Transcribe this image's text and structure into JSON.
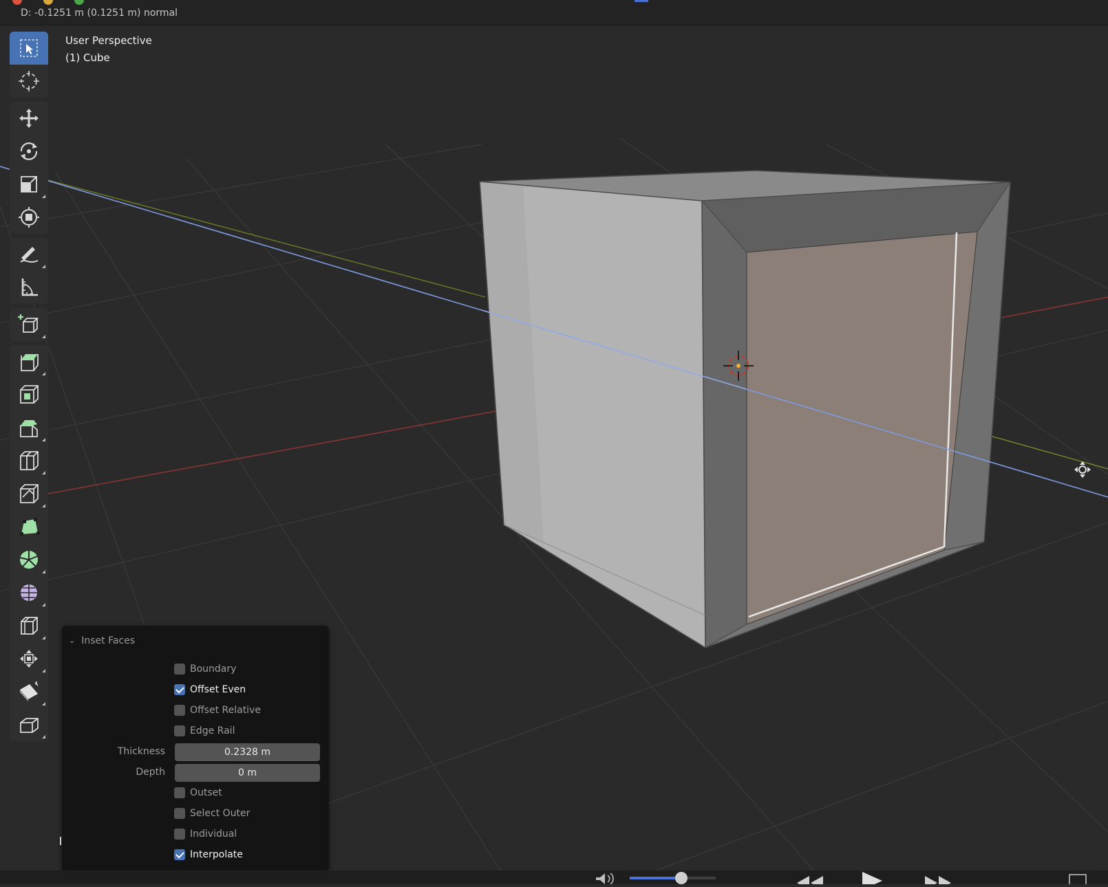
{
  "topbar": {
    "status": "D: -0.1251 m (0.1251 m) normal"
  },
  "viewport": {
    "view_name": "User Perspective",
    "object_name": "(1) Cube",
    "colors": {
      "background": "#2a2a2a",
      "grid": "#363636",
      "x_axis": "#a33a3a",
      "y_axis": "#8a9a2a",
      "normal_line": "#6f8fd8",
      "selected_face": "#8a7d75"
    }
  },
  "toolbar": {
    "tools": [
      {
        "id": "select-box",
        "icon": "select-box-icon"
      },
      {
        "id": "cursor",
        "icon": "3d-cursor-icon"
      },
      {
        "id": "move",
        "icon": "move-icon"
      },
      {
        "id": "rotate",
        "icon": "rotate-icon"
      },
      {
        "id": "scale",
        "icon": "scale-icon"
      },
      {
        "id": "transform",
        "icon": "transform-icon"
      },
      {
        "id": "annotate",
        "icon": "annotate-icon"
      },
      {
        "id": "measure",
        "icon": "measure-icon"
      },
      {
        "id": "add-cube",
        "icon": "add-cube-icon"
      },
      {
        "id": "extrude",
        "icon": "extrude-icon"
      },
      {
        "id": "inset",
        "icon": "inset-faces-icon"
      },
      {
        "id": "bevel",
        "icon": "bevel-icon"
      },
      {
        "id": "loop-cut",
        "icon": "loop-cut-icon"
      },
      {
        "id": "knife",
        "icon": "knife-icon"
      },
      {
        "id": "poly-build",
        "icon": "poly-build-icon"
      },
      {
        "id": "spin",
        "icon": "spin-icon"
      },
      {
        "id": "smooth",
        "icon": "smooth-icon"
      },
      {
        "id": "edge-slide",
        "icon": "edge-slide-icon"
      },
      {
        "id": "shrink-fatten",
        "icon": "shrink-fatten-icon"
      },
      {
        "id": "shear",
        "icon": "shear-icon"
      },
      {
        "id": "rip",
        "icon": "rip-icon"
      }
    ]
  },
  "panel": {
    "title": "Inset Faces",
    "options": [
      {
        "label": "Boundary",
        "checked": false
      },
      {
        "label": "Offset Even",
        "checked": true
      },
      {
        "label": "Offset Relative",
        "checked": false
      },
      {
        "label": "Edge Rail",
        "checked": false
      }
    ],
    "thickness_label": "Thickness",
    "thickness_value": "0.2328 m",
    "depth_label": "Depth",
    "depth_value": "0 m",
    "options2": [
      {
        "label": "Outset",
        "checked": false
      },
      {
        "label": "Select Outer",
        "checked": false
      },
      {
        "label": "Individual",
        "checked": false
      },
      {
        "label": "Interpolate",
        "checked": true
      }
    ]
  },
  "playback": {
    "volume_level": 0.6
  }
}
